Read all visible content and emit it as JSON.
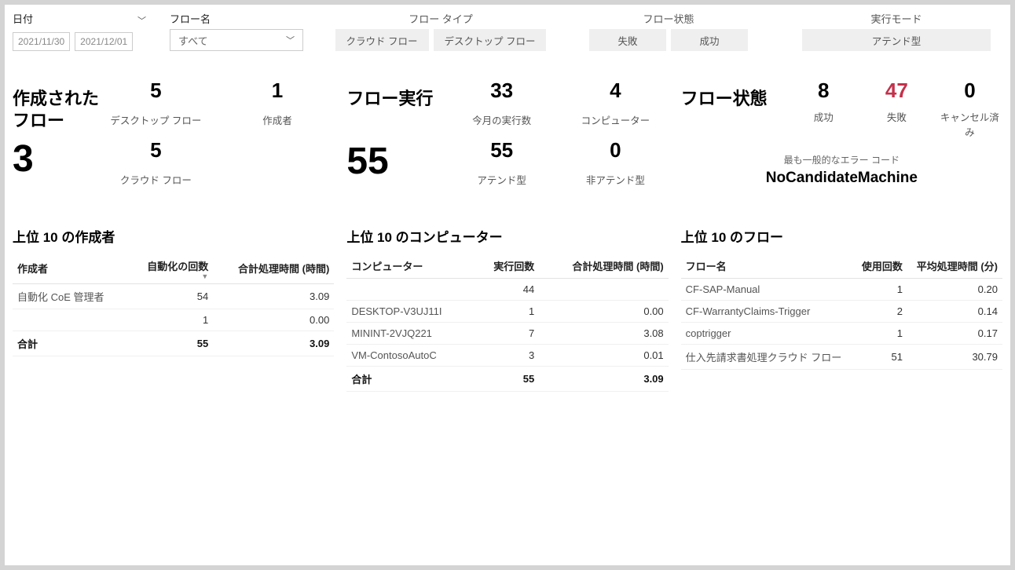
{
  "filters": {
    "date_label": "日付",
    "date_from": "2021/11/30",
    "date_to": "2021/12/01",
    "flowname_label": "フロー名",
    "flowname_value": "すべて",
    "flowtype_label": "フロー タイプ",
    "flowtype_btn1": "クラウド フロー",
    "flowtype_btn2": "デスクトップ フロー",
    "flowstate_label": "フロー状態",
    "flowstate_btn1": "失敗",
    "flowstate_btn2": "成功",
    "runmode_label": "実行モード",
    "runmode_btn": "アテンド型"
  },
  "kpi1": {
    "title": "作成されたフロー",
    "big": "3",
    "a_num": "5",
    "a_sub": "デスクトップ フロー",
    "b_num": "5",
    "b_sub": "クラウド フロー",
    "c_num": "1",
    "c_sub": "作成者"
  },
  "kpi2": {
    "title": "フロー実行",
    "big": "55",
    "a_num": "33",
    "a_sub": "今月の実行数",
    "b_num": "55",
    "b_sub": "アテンド型",
    "c_num": "4",
    "c_sub": "コンピューター",
    "d_num": "0",
    "d_sub": "非アテンド型"
  },
  "kpi3": {
    "title": "フロー状態",
    "a_num": "8",
    "a_sub": "成功",
    "b_num": "47",
    "b_sub": "失敗",
    "c_num": "0",
    "c_sub": "キャンセル済み",
    "err_caption": "最も一般的なエラー コード",
    "err_code": "NoCandidateMachine"
  },
  "t1": {
    "title": "上位 10 の作成者",
    "h1": "作成者",
    "h2": "自動化の回数",
    "h3": "合計処理時間 (時間)",
    "rows": [
      {
        "c1": "自動化 CoE 管理者",
        "c2": "54",
        "c3": "3.09"
      },
      {
        "c1": "",
        "c2": "1",
        "c3": "0.00"
      }
    ],
    "total_label": "合計",
    "total_c2": "55",
    "total_c3": "3.09"
  },
  "t2": {
    "title": "上位 10 のコンピューター",
    "h1": "コンピューター",
    "h2": "実行回数",
    "h3": "合計処理時間 (時間)",
    "rows": [
      {
        "c1": "",
        "c2": "44",
        "c3": ""
      },
      {
        "c1": "DESKTOP-V3UJ11I",
        "c2": "1",
        "c3": "0.00"
      },
      {
        "c1": "MININT-2VJQ221",
        "c2": "7",
        "c3": "3.08"
      },
      {
        "c1": "VM-ContosoAutoC",
        "c2": "3",
        "c3": "0.01"
      }
    ],
    "total_label": "合計",
    "total_c2": "55",
    "total_c3": "3.09"
  },
  "t3": {
    "title": "上位 10 のフロー",
    "h1": "フロー名",
    "h2": "使用回数",
    "h3": "平均処理時間 (分)",
    "rows": [
      {
        "c1": "CF-SAP-Manual",
        "c2": "1",
        "c3": "0.20"
      },
      {
        "c1": "CF-WarrantyClaims-Trigger",
        "c2": "2",
        "c3": "0.14"
      },
      {
        "c1": "coptrigger",
        "c2": "1",
        "c3": "0.17"
      },
      {
        "c1": "仕入先請求書処理クラウド フロー",
        "c2": "51",
        "c3": "30.79"
      }
    ]
  }
}
